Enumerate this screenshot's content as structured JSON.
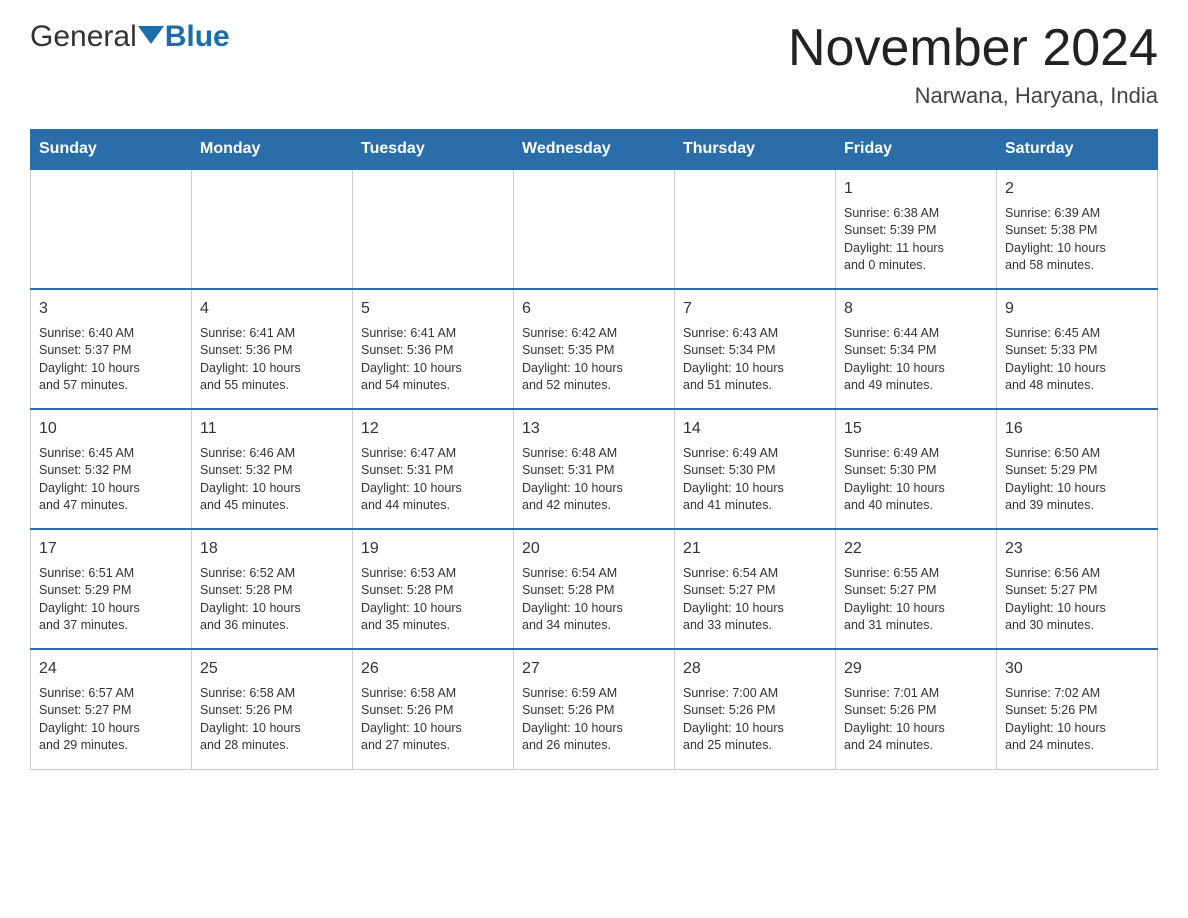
{
  "header": {
    "logo": {
      "general": "General",
      "blue": "Blue"
    },
    "title": "November 2024",
    "location": "Narwana, Haryana, India"
  },
  "weekdays": [
    "Sunday",
    "Monday",
    "Tuesday",
    "Wednesday",
    "Thursday",
    "Friday",
    "Saturday"
  ],
  "weeks": [
    [
      {
        "day": "",
        "info": ""
      },
      {
        "day": "",
        "info": ""
      },
      {
        "day": "",
        "info": ""
      },
      {
        "day": "",
        "info": ""
      },
      {
        "day": "",
        "info": ""
      },
      {
        "day": "1",
        "info": "Sunrise: 6:38 AM\nSunset: 5:39 PM\nDaylight: 11 hours\nand 0 minutes."
      },
      {
        "day": "2",
        "info": "Sunrise: 6:39 AM\nSunset: 5:38 PM\nDaylight: 10 hours\nand 58 minutes."
      }
    ],
    [
      {
        "day": "3",
        "info": "Sunrise: 6:40 AM\nSunset: 5:37 PM\nDaylight: 10 hours\nand 57 minutes."
      },
      {
        "day": "4",
        "info": "Sunrise: 6:41 AM\nSunset: 5:36 PM\nDaylight: 10 hours\nand 55 minutes."
      },
      {
        "day": "5",
        "info": "Sunrise: 6:41 AM\nSunset: 5:36 PM\nDaylight: 10 hours\nand 54 minutes."
      },
      {
        "day": "6",
        "info": "Sunrise: 6:42 AM\nSunset: 5:35 PM\nDaylight: 10 hours\nand 52 minutes."
      },
      {
        "day": "7",
        "info": "Sunrise: 6:43 AM\nSunset: 5:34 PM\nDaylight: 10 hours\nand 51 minutes."
      },
      {
        "day": "8",
        "info": "Sunrise: 6:44 AM\nSunset: 5:34 PM\nDaylight: 10 hours\nand 49 minutes."
      },
      {
        "day": "9",
        "info": "Sunrise: 6:45 AM\nSunset: 5:33 PM\nDaylight: 10 hours\nand 48 minutes."
      }
    ],
    [
      {
        "day": "10",
        "info": "Sunrise: 6:45 AM\nSunset: 5:32 PM\nDaylight: 10 hours\nand 47 minutes."
      },
      {
        "day": "11",
        "info": "Sunrise: 6:46 AM\nSunset: 5:32 PM\nDaylight: 10 hours\nand 45 minutes."
      },
      {
        "day": "12",
        "info": "Sunrise: 6:47 AM\nSunset: 5:31 PM\nDaylight: 10 hours\nand 44 minutes."
      },
      {
        "day": "13",
        "info": "Sunrise: 6:48 AM\nSunset: 5:31 PM\nDaylight: 10 hours\nand 42 minutes."
      },
      {
        "day": "14",
        "info": "Sunrise: 6:49 AM\nSunset: 5:30 PM\nDaylight: 10 hours\nand 41 minutes."
      },
      {
        "day": "15",
        "info": "Sunrise: 6:49 AM\nSunset: 5:30 PM\nDaylight: 10 hours\nand 40 minutes."
      },
      {
        "day": "16",
        "info": "Sunrise: 6:50 AM\nSunset: 5:29 PM\nDaylight: 10 hours\nand 39 minutes."
      }
    ],
    [
      {
        "day": "17",
        "info": "Sunrise: 6:51 AM\nSunset: 5:29 PM\nDaylight: 10 hours\nand 37 minutes."
      },
      {
        "day": "18",
        "info": "Sunrise: 6:52 AM\nSunset: 5:28 PM\nDaylight: 10 hours\nand 36 minutes."
      },
      {
        "day": "19",
        "info": "Sunrise: 6:53 AM\nSunset: 5:28 PM\nDaylight: 10 hours\nand 35 minutes."
      },
      {
        "day": "20",
        "info": "Sunrise: 6:54 AM\nSunset: 5:28 PM\nDaylight: 10 hours\nand 34 minutes."
      },
      {
        "day": "21",
        "info": "Sunrise: 6:54 AM\nSunset: 5:27 PM\nDaylight: 10 hours\nand 33 minutes."
      },
      {
        "day": "22",
        "info": "Sunrise: 6:55 AM\nSunset: 5:27 PM\nDaylight: 10 hours\nand 31 minutes."
      },
      {
        "day": "23",
        "info": "Sunrise: 6:56 AM\nSunset: 5:27 PM\nDaylight: 10 hours\nand 30 minutes."
      }
    ],
    [
      {
        "day": "24",
        "info": "Sunrise: 6:57 AM\nSunset: 5:27 PM\nDaylight: 10 hours\nand 29 minutes."
      },
      {
        "day": "25",
        "info": "Sunrise: 6:58 AM\nSunset: 5:26 PM\nDaylight: 10 hours\nand 28 minutes."
      },
      {
        "day": "26",
        "info": "Sunrise: 6:58 AM\nSunset: 5:26 PM\nDaylight: 10 hours\nand 27 minutes."
      },
      {
        "day": "27",
        "info": "Sunrise: 6:59 AM\nSunset: 5:26 PM\nDaylight: 10 hours\nand 26 minutes."
      },
      {
        "day": "28",
        "info": "Sunrise: 7:00 AM\nSunset: 5:26 PM\nDaylight: 10 hours\nand 25 minutes."
      },
      {
        "day": "29",
        "info": "Sunrise: 7:01 AM\nSunset: 5:26 PM\nDaylight: 10 hours\nand 24 minutes."
      },
      {
        "day": "30",
        "info": "Sunrise: 7:02 AM\nSunset: 5:26 PM\nDaylight: 10 hours\nand 24 minutes."
      }
    ]
  ]
}
